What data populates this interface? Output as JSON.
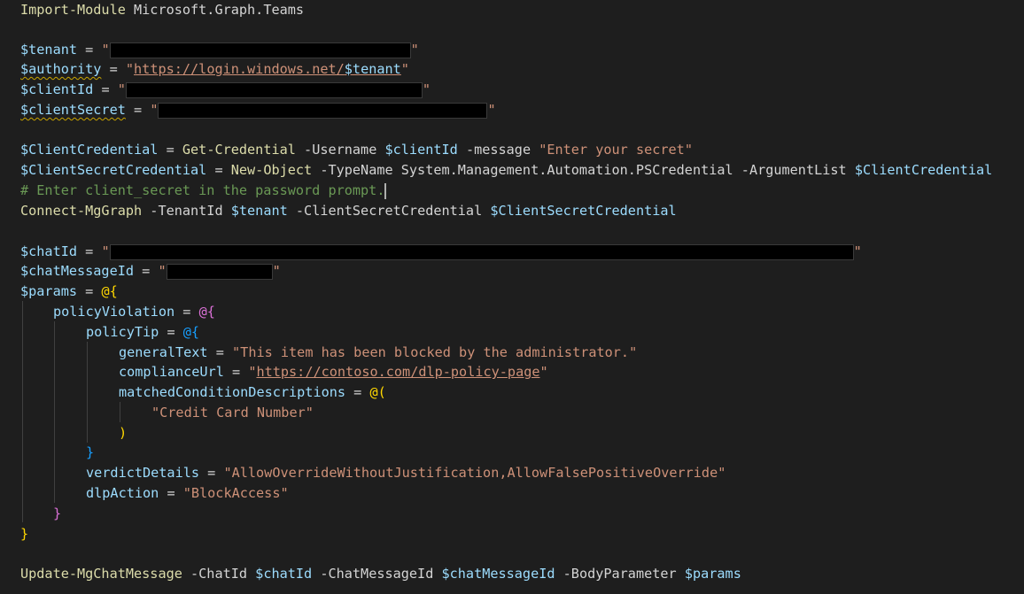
{
  "code": {
    "line1": {
      "cmd": "Import-Module",
      "arg": " Microsoft.Graph.Teams"
    },
    "tenant": {
      "var": "$tenant",
      "eq": " = ",
      "q1": "\"",
      "q2": "\""
    },
    "authority": {
      "var": "$authority",
      "eq": " = ",
      "q1": "\"",
      "url": "https://login.windows.net/",
      "urlvar": "$tenant",
      "q2": "\""
    },
    "clientId": {
      "var": "$clientId",
      "eq": " = ",
      "q1": "\"",
      "q2": "\""
    },
    "clientSecret": {
      "var": "$clientSecret",
      "eq": " = ",
      "q1": "\"",
      "q2": "\""
    },
    "cred": {
      "var": "$ClientCredential",
      "eq": " = ",
      "cmd": "Get-Credential",
      "p1": " -Username ",
      "v1": "$clientId",
      "p2": " -message ",
      "str": "\"Enter your secret\""
    },
    "secretCred": {
      "var": "$ClientSecretCredential",
      "eq": " = ",
      "cmd": "New-Object",
      "p1": " -TypeName System.Management.Automation.PSCredential -ArgumentList ",
      "v1": "$ClientCredential"
    },
    "comment": "# Enter client_secret in the password prompt.",
    "connect": {
      "cmd": "Connect-MgGraph",
      "p1": " -TenantId ",
      "v1": "$tenant",
      "p2": " -ClientSecretCredential ",
      "v2": "$ClientSecretCredential"
    },
    "chatId": {
      "var": "$chatId",
      "eq": " = ",
      "q1": "\"",
      "q2": "\""
    },
    "chatMessageId": {
      "var": "$chatMessageId",
      "eq": " = ",
      "q1": "\"",
      "q2": "\""
    },
    "params": {
      "var": "$params",
      "eq": " = ",
      "at": "@",
      "brace": "{"
    },
    "policyViolation": {
      "key": "policyViolation",
      "eq": " = ",
      "at": "@",
      "brace": "{"
    },
    "policyTip": {
      "key": "policyTip",
      "eq": " = ",
      "at": "@",
      "brace": "{"
    },
    "generalText": {
      "key": "generalText",
      "eq": " = ",
      "str": "\"This item has been blocked by the administrator.\""
    },
    "complianceUrl": {
      "key": "complianceUrl",
      "eq": " = ",
      "q1": "\"",
      "url": "https://contoso.com/dlp-policy-page",
      "q2": "\""
    },
    "matched": {
      "key": "matchedConditionDescriptions",
      "eq": " = ",
      "at": "@",
      "paren": "("
    },
    "creditCard": "\"Credit Card Number\"",
    "closeParen": ")",
    "closeBrace3": "}",
    "verdict": {
      "key": "verdictDetails",
      "eq": " = ",
      "str": "\"AllowOverrideWithoutJustification,AllowFalsePositiveOverride\""
    },
    "dlpAction": {
      "key": "dlpAction",
      "eq": " = ",
      "str": "\"BlockAccess\""
    },
    "closeBrace2": "}",
    "closeBrace1": "}",
    "update": {
      "cmd": "Update-MgChatMessage",
      "p1": " -ChatId ",
      "v1": "$chatId",
      "p2": " -ChatMessageId ",
      "v2": "$chatMessageId",
      "p3": " -BodyParameter ",
      "v3": "$params"
    }
  },
  "colors": {
    "background": "#1e1e1e",
    "command": "#dcdcaa",
    "variable": "#9cdcfe",
    "string": "#ce9178",
    "comment": "#6a9955",
    "bracket1": "#ffd700",
    "bracket2": "#da70d6",
    "bracket3": "#179fff"
  }
}
